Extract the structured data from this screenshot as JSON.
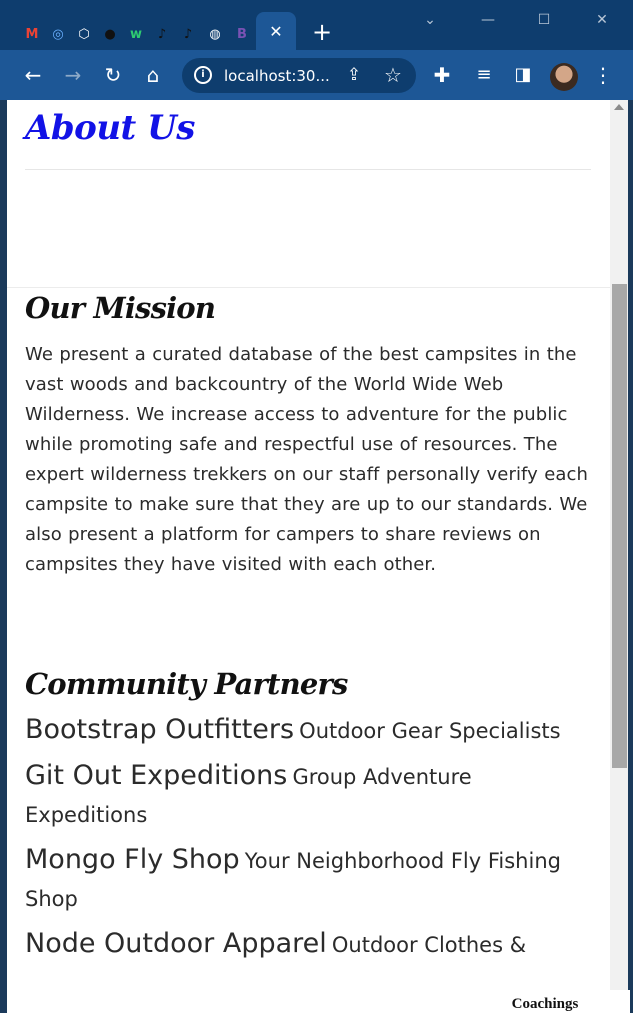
{
  "browser": {
    "tabs": [
      {
        "icon": "gmail-icon",
        "glyph": "M",
        "color": "#ea4335"
      },
      {
        "icon": "site-icon",
        "glyph": "◎",
        "color": "#6ab0ff"
      },
      {
        "icon": "codepen-icon",
        "glyph": "⬡",
        "color": "#ffffff"
      },
      {
        "icon": "github-icon",
        "glyph": "●",
        "color": "#111111"
      },
      {
        "icon": "w-icon",
        "glyph": "w",
        "color": "#2ecc71"
      },
      {
        "icon": "tiktok-icon",
        "glyph": "♪",
        "color": "#111111"
      },
      {
        "icon": "tiktok-icon-2",
        "glyph": "♪",
        "color": "#111111"
      },
      {
        "icon": "globe-icon",
        "glyph": "◍",
        "color": "#ffffff"
      },
      {
        "icon": "bootstrap-icon",
        "glyph": "B",
        "color": "#7952b3"
      }
    ],
    "url": "localhost:30..."
  },
  "page": {
    "about_title": "About Us",
    "mission_title": "Our Mission",
    "mission_text": "We present a curated database of the best campsites in the vast woods and backcountry of the World Wide Web Wilderness. We increase access to adventure for the public while promoting safe and respectful use of resources. The expert wilderness trekkers on our staff personally verify each campsite to make sure that they are up to our standards. We also present a platform for campers to share reviews on campsites they have visited with each other.",
    "partners_title": "Community Partners",
    "partners": [
      {
        "name": "Bootstrap Outfitters",
        "desc": "Outdoor Gear Specialists"
      },
      {
        "name": "Git Out Expeditions",
        "desc": "Group Adventure Expeditions"
      },
      {
        "name": "Mongo Fly Shop",
        "desc": "Your Neighborhood Fly Fishing Shop"
      },
      {
        "name": "Node Outdoor Apparel",
        "desc": "Outdoor Clothes &"
      }
    ]
  },
  "overlay": {
    "peek_text": "Coachings"
  },
  "colors": {
    "about_title": "#1212e6",
    "tabbar": "#0e3d6e",
    "toolbar": "#1d5796"
  }
}
